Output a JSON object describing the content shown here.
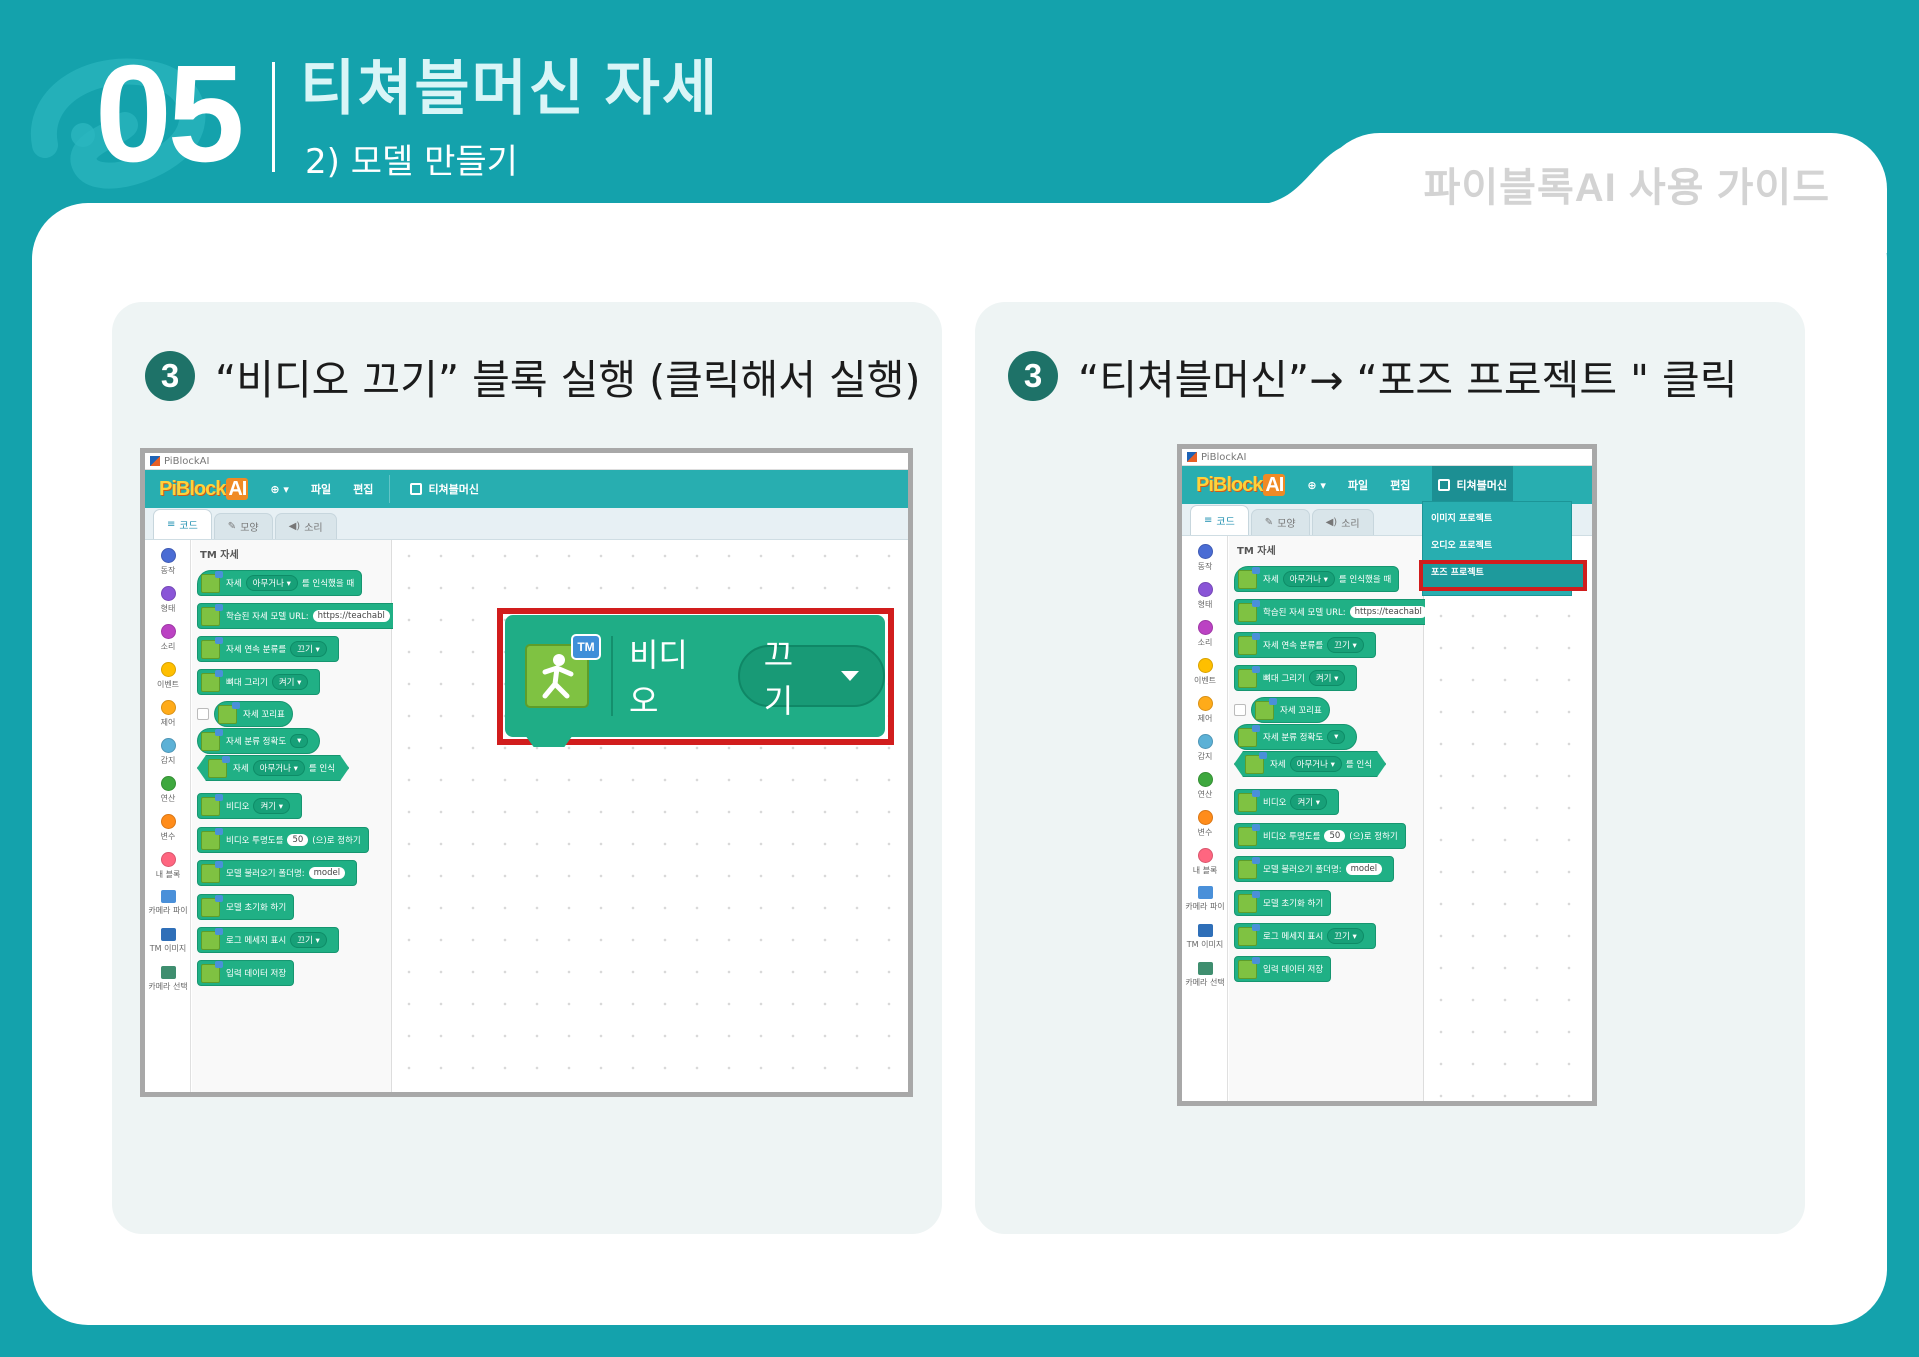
{
  "header": {
    "chapter_number": "05",
    "title": "티쳐블머신 자세",
    "subtitle": "2) 모델 만들기",
    "guide_title": "파이블록AI 사용 가이드"
  },
  "left_panel": {
    "step_number": "3",
    "instruction": "“비디오 끄기” 블록 실행 (클릭해서 실행)"
  },
  "right_panel": {
    "step_number": "3",
    "instruction": "“티쳐블머신”→ “포즈 프로젝트 \" 클릭"
  },
  "app": {
    "window_title": "PiBlockAI",
    "brand_main": "PiBlock",
    "brand_ai": "AI",
    "menu": {
      "file": "파일",
      "edit": "편집",
      "teachable": "티쳐블머신"
    },
    "tabs": [
      "코드",
      "모양",
      "소리"
    ],
    "categories": [
      {
        "label": "동작",
        "color": "#4a6cd4"
      },
      {
        "label": "형태",
        "color": "#8a55d7"
      },
      {
        "label": "소리",
        "color": "#bb42c3"
      },
      {
        "label": "이벤트",
        "color": "#ffbf00"
      },
      {
        "label": "제어",
        "color": "#ffab19"
      },
      {
        "label": "감지",
        "color": "#5cb1d6"
      },
      {
        "label": "연산",
        "color": "#3ea83e"
      },
      {
        "label": "변수",
        "color": "#ff8c1a"
      },
      {
        "label": "내 블록",
        "color": "#ff6680"
      },
      {
        "label": "카메라 파이",
        "color": "#4a90d9"
      },
      {
        "label": "TM 이미지",
        "color": "#2f6fb8"
      },
      {
        "label": "카메라 선택",
        "color": "#3f8e6f"
      }
    ],
    "flyout_header": "TM 자세",
    "blocks": {
      "b1": {
        "pre": "자세",
        "dd": "아무거나 ▾",
        "post": "를 인식했을 때"
      },
      "b2": {
        "pre": "학습된 자세 모델 URL:",
        "oval": "https://teachabl"
      },
      "b3": {
        "pre": "자세 연속 분류를",
        "dd": "끄기 ▾"
      },
      "b4": {
        "pre": "뼈대 그리기",
        "dd": "켜기 ▾"
      },
      "b5": {
        "pre": "자세 꼬리표"
      },
      "b6": {
        "pre": "자세 분류 정확도",
        "dd": "▾"
      },
      "b7": {
        "pre": "자세",
        "dd": "아무거나 ▾",
        "post": "를 인식"
      },
      "b8": {
        "pre": "비디오",
        "dd": "켜기 ▾"
      },
      "b9": {
        "pre": "비디오 투명도를",
        "oval": "50",
        "post": "(으)로 정하기"
      },
      "b10": {
        "pre": "모델 불러오기 폴더명:",
        "oval": "model"
      },
      "b11": {
        "pre": "모델 초기화 하기"
      },
      "b12": {
        "pre": "로그 메세지 표시",
        "dd": "끄기 ▾"
      },
      "b13": {
        "pre": "입력 데이터 저장"
      }
    },
    "big_block": {
      "tm_badge": "TM",
      "label": "비디오",
      "dropdown": "끄기"
    },
    "tm_dropdown": [
      "이미지 프로젝트",
      "오디오 프로젝트",
      "포즈 프로젝트"
    ]
  }
}
